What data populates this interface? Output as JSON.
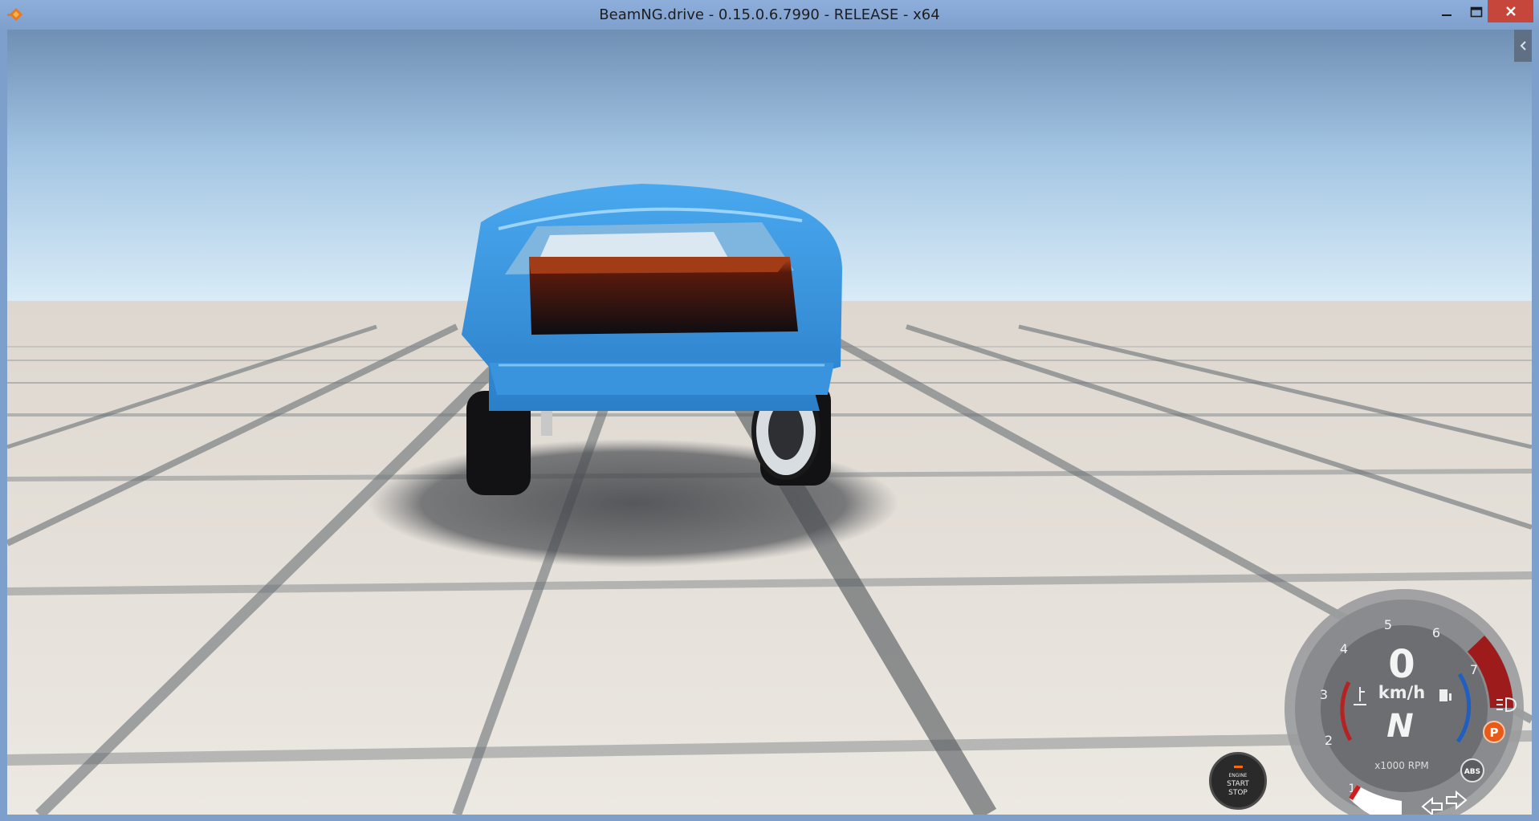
{
  "window": {
    "title": "BeamNG.drive - 0.15.0.6.7990 - RELEASE - x64"
  },
  "engine_button": {
    "line1": "ENGINE",
    "line2": "START",
    "line3": "STOP"
  },
  "dashboard": {
    "speed": "0",
    "speed_unit": "km/h",
    "gear": "N",
    "rpm_unit": "x1000 RPM",
    "rpm_ticks": [
      "1",
      "2",
      "3",
      "4",
      "5",
      "6",
      "7"
    ],
    "parking_brake": "P",
    "abs_label": "ABS",
    "colors": {
      "redline": "#9e1b1b",
      "fuel_arc": "#1f5fbf",
      "temp_arc": "#b52222",
      "parking": "#e85a1a"
    }
  },
  "icons": [
    "app-icon",
    "minimize-icon",
    "maximize-icon",
    "close-icon",
    "collapse-chevron-icon",
    "temperature-icon",
    "fuel-icon",
    "headlight-icon",
    "turn-left-icon",
    "turn-right-icon"
  ]
}
